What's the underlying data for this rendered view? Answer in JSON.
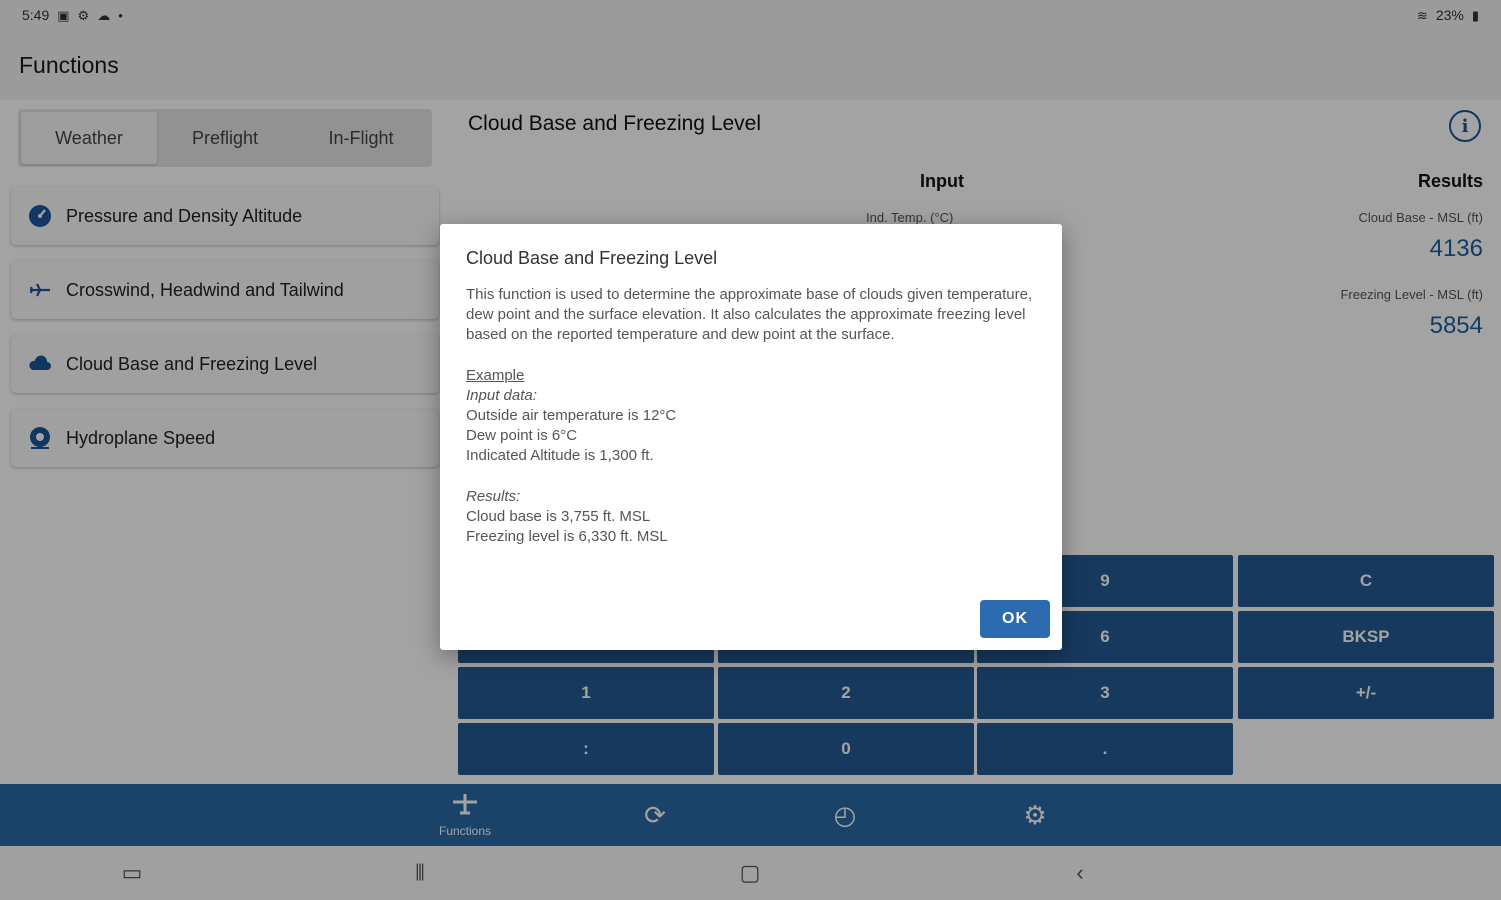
{
  "status_bar": {
    "time": "5:49",
    "right": "23%"
  },
  "app_bar": {
    "title": "Functions"
  },
  "tabs": [
    {
      "label": "Weather",
      "active": true
    },
    {
      "label": "Preflight",
      "active": false
    },
    {
      "label": "In-Flight",
      "active": false
    }
  ],
  "functions": [
    {
      "label": "Pressure and Density Altitude",
      "icon": "gauge-icon"
    },
    {
      "label": "Crosswind, Headwind and Tailwind",
      "icon": "plane-icon"
    },
    {
      "label": "Cloud Base and Freezing Level",
      "icon": "cloud-icon"
    },
    {
      "label": "Hydroplane Speed",
      "icon": "water-icon"
    }
  ],
  "calculator": {
    "title": "Cloud Base and Freezing Level",
    "input_header": "Input",
    "results_header": "Results",
    "input_label": "Ind. Temp. (°C)",
    "results": [
      {
        "label": "Cloud Base - MSL (ft)",
        "value": "4136"
      },
      {
        "label": "Freezing Level - MSL (ft)",
        "value": "5854"
      }
    ]
  },
  "keypad": {
    "keys": [
      "9",
      "C",
      "6",
      "BKSP",
      "1",
      "2",
      "3",
      "+/-",
      ":",
      "0",
      "."
    ]
  },
  "bottom_nav": {
    "functions_label": "Functions"
  },
  "dialog": {
    "title": "Cloud Base and Freezing Level",
    "description": "This function is used to determine the approximate base of clouds given temperature, dew point and the surface elevation. It also calculates the approximate freezing level based on the reported temperature and dew point at the surface.",
    "example_title": "Example",
    "input_heading": "Input data:",
    "input_lines": [
      "Outside air temperature is 12°C",
      "Dew point is 6°C",
      "Indicated Altitude is 1,300 ft."
    ],
    "results_heading": "Results:",
    "result_lines": [
      "Cloud base is 3,755 ft. MSL",
      "Freezing level is 6,330 ft. MSL"
    ],
    "ok_label": "OK"
  },
  "colors": {
    "accent": "#245a93",
    "nav": "#2b6aa7",
    "result_value": "#1f5f9f"
  }
}
